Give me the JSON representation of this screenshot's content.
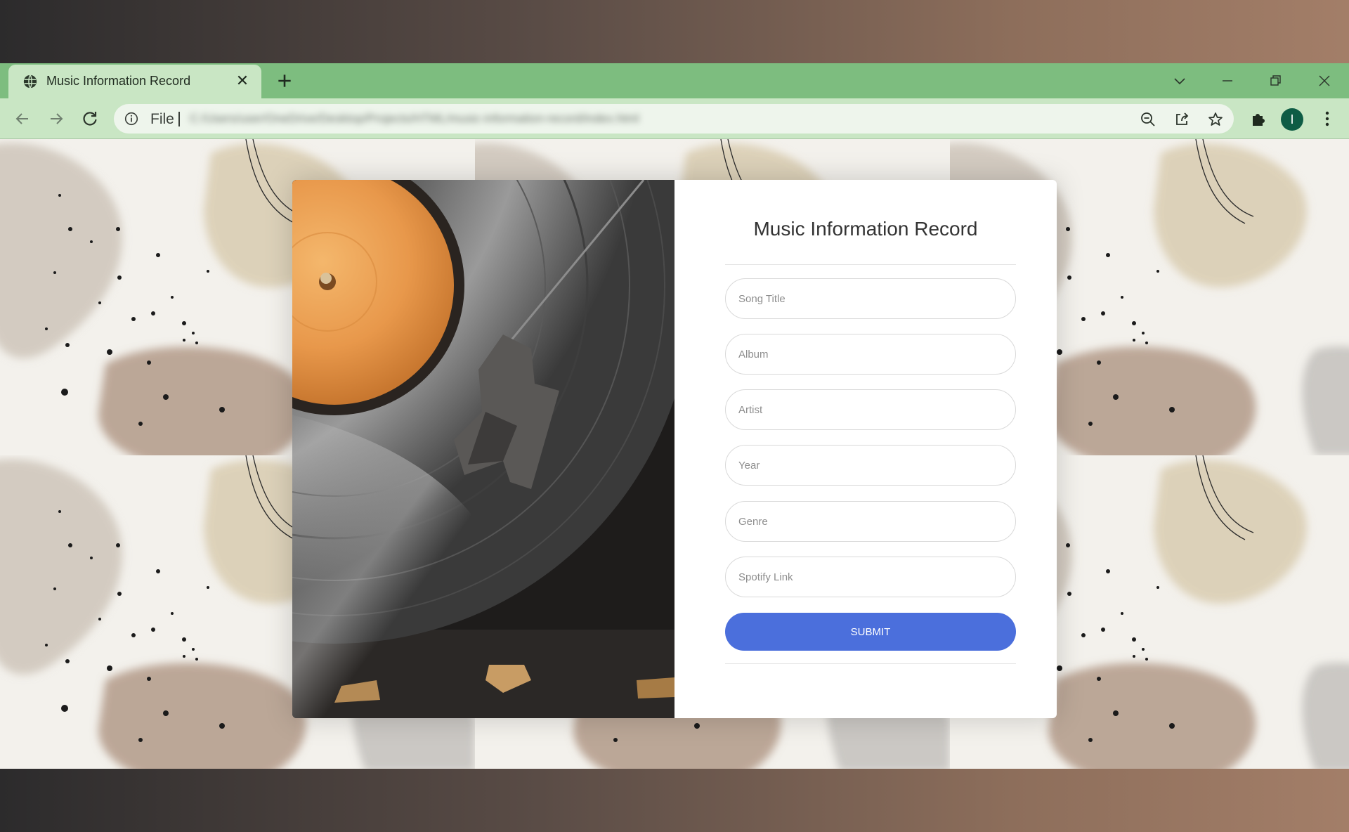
{
  "browser": {
    "tab": {
      "title": "Music Information Record",
      "favicon": "globe-icon"
    },
    "toolbar": {
      "scheme_label": "File",
      "url_blurred": "C:/Users/user/OneDrive/Desktop/Projects/HTML/music-information-record/index.html"
    },
    "profile_initial": "I",
    "icons": [
      "back-arrow-icon",
      "forward-arrow-icon",
      "reload-icon",
      "info-icon",
      "zoom-out-icon",
      "share-icon",
      "star-icon",
      "extensions-icon",
      "more-vert-icon",
      "chevron-down-icon",
      "minimize-icon",
      "restore-icon",
      "close-icon",
      "plus-icon"
    ]
  },
  "page": {
    "form": {
      "title": "Music Information Record",
      "fields": {
        "song_title": {
          "placeholder": "Song Title",
          "value": ""
        },
        "album": {
          "placeholder": "Album",
          "value": ""
        },
        "artist": {
          "placeholder": "Artist",
          "value": ""
        },
        "year": {
          "placeholder": "Year",
          "value": ""
        },
        "genre": {
          "placeholder": "Genre",
          "value": ""
        },
        "spotify_link": {
          "placeholder": "Spotify Link",
          "value": ""
        }
      },
      "submit_label": "SUBMIT"
    },
    "colors": {
      "tab_strip": "#7dbd7f",
      "toolbar": "#c9e6c4",
      "submit_button": "#4b6fdc",
      "avatar": "#0e5c45"
    }
  }
}
